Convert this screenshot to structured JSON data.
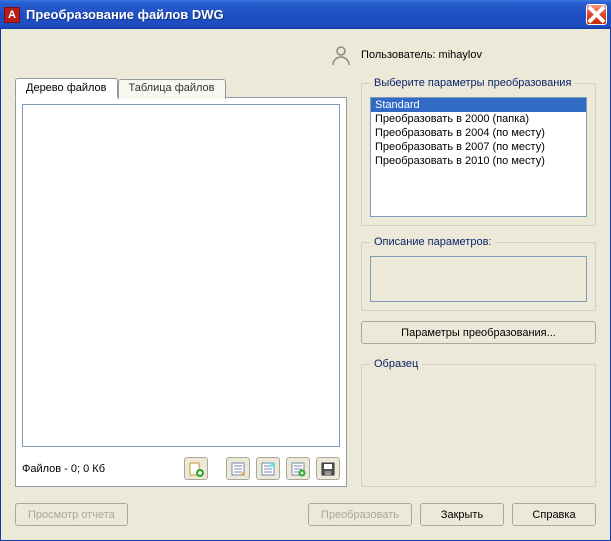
{
  "window": {
    "title": "Преобразование файлов DWG",
    "app_icon_text": "A"
  },
  "user": {
    "label": "Пользователь: mihaylov"
  },
  "tabs": {
    "tree": "Дерево файлов",
    "table": "Таблица файлов"
  },
  "status": {
    "files": "Файлов - 0; 0 Кб"
  },
  "right": {
    "params_group": "Выберите параметры преобразования",
    "list": [
      "Standard",
      "Преобразовать в 2000 (папка)",
      "Преобразовать в 2004 (по месту)",
      "Преобразовать в 2007 (по месту)",
      "Преобразовать в 2010 (по месту)"
    ],
    "selected_index": 0,
    "desc_group": "Описание параметров:",
    "params_button": "Параметры преобразования...",
    "sample_group": "Образец"
  },
  "buttons": {
    "view_report": "Просмотр отчета",
    "convert": "Преобразовать",
    "close": "Закрыть",
    "help": "Справка"
  },
  "icons": {
    "add_file": "add-file-icon",
    "new_list": "new-list-icon",
    "open_list": "open-list-icon",
    "append_list": "append-list-icon",
    "save_list": "save-list-icon"
  }
}
